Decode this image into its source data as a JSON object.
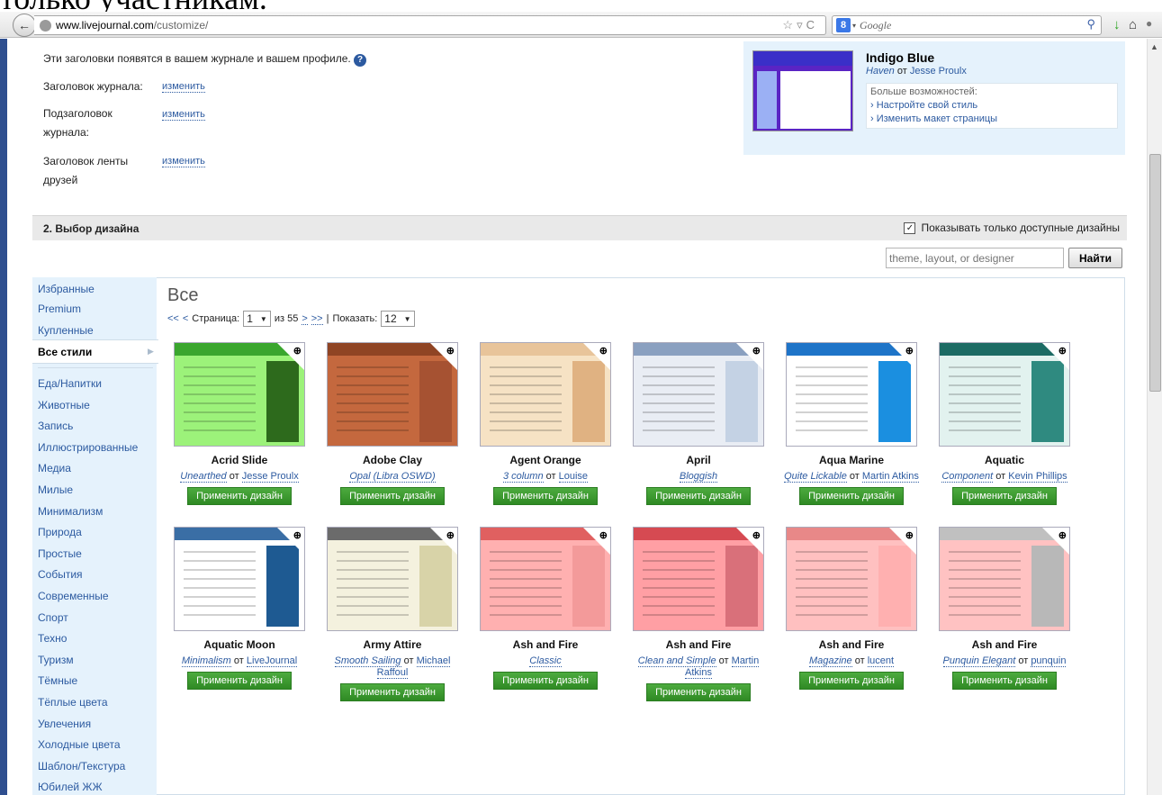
{
  "heading": {
    "clipped_text": "только участникам."
  },
  "browser": {
    "url_host": "www.livejournal.com",
    "url_path": "/customize/",
    "search_engine": "Google"
  },
  "section1": {
    "intro": "Эти заголовки появятся в вашем журнале и вашем профиле.",
    "rows": [
      {
        "label": "Заголовок журнала:",
        "link": "изменить"
      },
      {
        "label": "Подзаголовок журнала:",
        "link": "изменить"
      },
      {
        "label": "Заголовок ленты друзей",
        "link": "изменить"
      }
    ]
  },
  "current_theme": {
    "name": "Indigo Blue",
    "layout": "Haven",
    "by": "от",
    "designer": "Jesse Proulx",
    "more_label": "Больше возможностей:",
    "link1": "› Настройте свой стиль",
    "link2": "› Изменить макет страницы"
  },
  "section2": {
    "title": "2. Выбор дизайна",
    "show_available": "Показывать только доступные дизайны",
    "search_placeholder": "theme, layout, or designer",
    "find_button": "Найти"
  },
  "sidebar": {
    "top_items": [
      "Избранные",
      "Premium",
      "Купленные"
    ],
    "active": "Все стили",
    "categories": [
      "Еда/Напитки",
      "Животные",
      "Запись",
      "Иллюстрированные",
      "Медиа",
      "Милые",
      "Минимализм",
      "Природа",
      "Простые",
      "События",
      "Современные",
      "Спорт",
      "Техно",
      "Туризм",
      "Тёмные",
      "Тёплые цвета",
      "Увлечения",
      "Холодные цвета",
      "Шаблон/Текстура",
      "Юбилей ЖЖ"
    ]
  },
  "gallery": {
    "title": "Все",
    "pager": {
      "first": "<<",
      "prev": "<",
      "page_label": "Страница:",
      "page": "1",
      "of": "из 55",
      "next": ">",
      "last": ">>",
      "sep": "|",
      "show_label": "Показать:",
      "show": "12"
    },
    "apply_label": "Применить дизайн",
    "by": "от",
    "themes": [
      {
        "name": "Acrid Slide",
        "layout": "Unearthed",
        "designer": "Jesse Proulx",
        "bg": "#9cf27a",
        "hdr": "#3aa62e",
        "side": "#2d6a1c"
      },
      {
        "name": "Adobe Clay",
        "layout": "Opal (Libra OSWD)",
        "designer": "",
        "bg": "#c4683e",
        "hdr": "#8f4424",
        "side": "#a65232"
      },
      {
        "name": "Agent Orange",
        "layout": "3 column",
        "designer": "Louise",
        "bg": "#f6e2c4",
        "hdr": "#e8c49a",
        "side": "#e0b282"
      },
      {
        "name": "April",
        "layout": "Bloggish",
        "designer": "",
        "bg": "#e9edf4",
        "hdr": "#8aa0c0",
        "side": "#c4d2e4"
      },
      {
        "name": "Aqua Marine",
        "layout": "Quite Lickable",
        "designer": "Martin Atkins",
        "bg": "#ffffff",
        "hdr": "#1e74c8",
        "side": "#1b8fe0"
      },
      {
        "name": "Aquatic",
        "layout": "Component",
        "designer": "Kevin Phillips",
        "bg": "#e2f2ef",
        "hdr": "#1c6b64",
        "side": "#2f8a80"
      },
      {
        "name": "Aquatic Moon",
        "layout": "Minimalism",
        "designer": "LiveJournal",
        "bg": "#ffffff",
        "hdr": "#3a6ea5",
        "side": "#1e5a92"
      },
      {
        "name": "Army Attire",
        "layout": "Smooth Sailing",
        "designer": "Michael Raffoul",
        "bg": "#f4f1de",
        "hdr": "#6b6b6b",
        "side": "#d8d3a8"
      },
      {
        "name": "Ash and Fire",
        "layout": "Classic",
        "designer": "",
        "bg": "#ffb0b0",
        "hdr": "#e06060",
        "side": "#f39a9a"
      },
      {
        "name": "Ash and Fire",
        "layout": "Clean and Simple",
        "designer": "Martin Atkins",
        "bg": "#ff9fa4",
        "hdr": "#d64a52",
        "side": "#d9707a"
      },
      {
        "name": "Ash and Fire",
        "layout": "Magazine",
        "designer": "lucent",
        "bg": "#ffc0c0",
        "hdr": "#e88888",
        "side": "#ffb0b0"
      },
      {
        "name": "Ash and Fire",
        "layout": "Punquin Elegant",
        "designer": "punquin",
        "bg": "#ffc2c2",
        "hdr": "#c0c0c0",
        "side": "#b8b8b8"
      }
    ]
  }
}
